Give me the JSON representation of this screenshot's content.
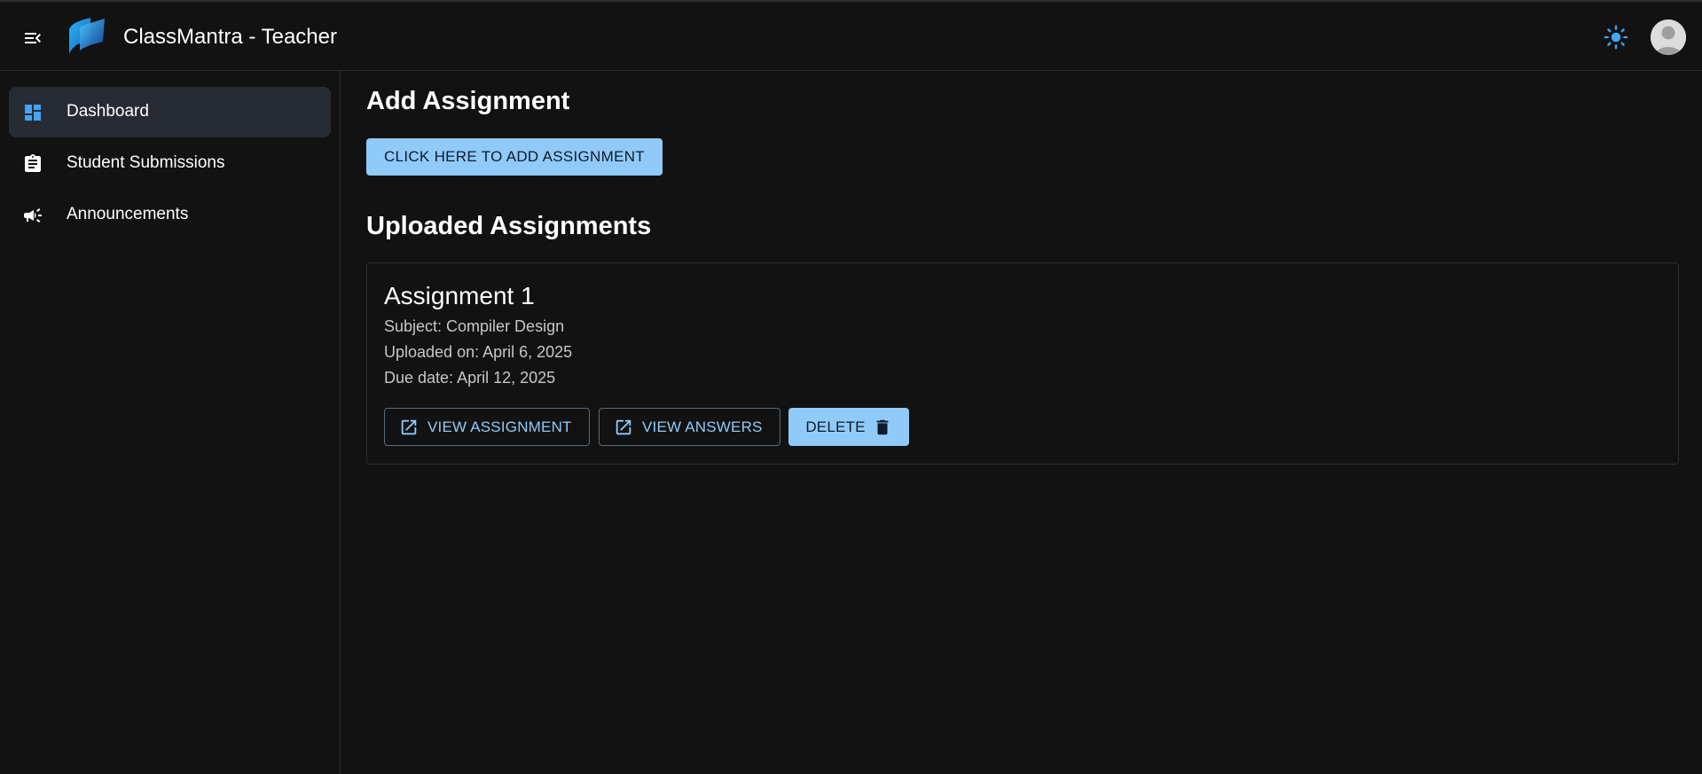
{
  "header": {
    "app_title": "ClassMantra - Teacher",
    "menu_icon": "menu-open-icon",
    "logo": "classmantra-logo",
    "theme_icon": "sun-icon",
    "avatar_icon": "user-avatar"
  },
  "sidebar": {
    "items": [
      {
        "label": "Dashboard",
        "icon": "dashboard-icon",
        "active": true
      },
      {
        "label": "Student Submissions",
        "icon": "assignment-icon",
        "active": false
      },
      {
        "label": "Announcements",
        "icon": "campaign-icon",
        "active": false
      }
    ]
  },
  "main": {
    "add_heading": "Add Assignment",
    "add_button": "CLICK HERE TO ADD ASSIGNMENT",
    "uploaded_heading": "Uploaded Assignments",
    "assignments": [
      {
        "title": "Assignment 1",
        "subject": "Subject: Compiler Design",
        "uploaded": "Uploaded on: April 6, 2025",
        "due": "Due date: April 12, 2025",
        "view_assignment": "VIEW ASSIGNMENT",
        "view_answers": "VIEW ANSWERS",
        "delete": "DELETE"
      }
    ]
  },
  "colors": {
    "background": "#121212",
    "accent": "#90caf9",
    "active_nav": "#272b33",
    "nav_icon_active": "#42a5f5"
  }
}
